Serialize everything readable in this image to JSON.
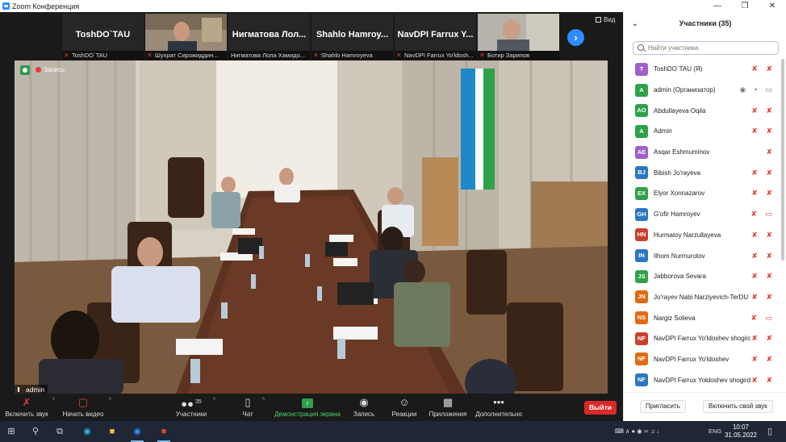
{
  "window": {
    "title": "Zoom Конференция",
    "buttons": [
      "—",
      "❒",
      "✕"
    ]
  },
  "gallery": {
    "tiles": [
      {
        "big": "ToshDO`TAU",
        "caption": "ToshDO`TAU",
        "muted": true,
        "photo": false
      },
      {
        "big": "",
        "caption": "Шухрат Сирожиддин...",
        "muted": true,
        "photo": true
      },
      {
        "big": "Нигматова Лол...",
        "caption": "Нигматова Лола Хамидо...",
        "muted": false,
        "photo": false
      },
      {
        "big": "Shahlo Hamroy...",
        "caption": "Shahlo Hamroyeva",
        "muted": true,
        "photo": false
      },
      {
        "big": "NavDPI Farrux Y...",
        "caption": "NavDPI Farrux Yo'ldosh...",
        "muted": true,
        "photo": false
      },
      {
        "big": "",
        "caption": "Ботир Зарипов",
        "muted": true,
        "photo": true
      }
    ],
    "view_label": "Вид"
  },
  "main_video": {
    "recording_label": "Запись",
    "speaker_name": "admin"
  },
  "toolbar": {
    "unmute": "Включить звук",
    "start_video": "Начать видео",
    "participants": "Участники",
    "participants_count": "35",
    "chat": "Чат",
    "share_screen": "Демонстрация экрана",
    "record": "Запись",
    "reactions": "Реакции",
    "apps": "Приложения",
    "more": "Дополнительно",
    "leave": "Выйти"
  },
  "panel": {
    "title": "Участники (35)",
    "search_placeholder": "Найти участника",
    "participants": [
      {
        "initials": "T",
        "name": "ToshDO`TAU (Я)",
        "color": "#a05fc9",
        "icons": "mic-off video-off"
      },
      {
        "initials": "A",
        "name": "admin (Организатор)",
        "color": "#2ea14a",
        "icons": "active"
      },
      {
        "initials": "AO",
        "name": "Abdullayeva Oqila",
        "color": "#2ea14a",
        "icons": "mic-off video-off"
      },
      {
        "initials": "A",
        "name": "Admin",
        "color": "#2ea14a",
        "icons": "mic-off video-off"
      },
      {
        "initials": "AE",
        "name": "Asqar Eshmuminov",
        "color": "#a05fc9",
        "icons": "mic-off"
      },
      {
        "initials": "BJ",
        "name": "Bibish Jo'rayeva",
        "color": "#2d76c2",
        "icons": "mic-off video-off"
      },
      {
        "initials": "EX",
        "name": "Elyor Xonnazarov",
        "color": "#2ea14a",
        "icons": "mic-off video-off"
      },
      {
        "initials": "GH",
        "name": "G'ofir Hamroyev",
        "color": "#2d76c2",
        "icons": "mic-off video-on"
      },
      {
        "initials": "HN",
        "name": "Hurmatoy Narzullayeva",
        "color": "#c94030",
        "icons": "mic-off video-off"
      },
      {
        "initials": "IN",
        "name": "Ilhom Nurmurotov",
        "color": "#2d76c2",
        "icons": "mic-off video-off"
      },
      {
        "initials": "JS",
        "name": "Jabborova Sevara",
        "color": "#2ea14a",
        "icons": "mic-off video-off"
      },
      {
        "initials": "JN",
        "name": "Jo'rayev Nabi Narziyevich-TerDU",
        "color": "#e06a10",
        "icons": "mic-off video-off"
      },
      {
        "initials": "NS",
        "name": "Nargiz Solieva",
        "color": "#e06a10",
        "icons": "mic-off video-on"
      },
      {
        "initials": "NF",
        "name": "NavDPI Farrux Yo'ldoshev shogird...",
        "color": "#c94030",
        "icons": "mic-off video-off"
      },
      {
        "initials": "NF",
        "name": "NavDPI Farrux Yo'ldoshev",
        "color": "#e06a10",
        "icons": "mic-off video-off"
      },
      {
        "initials": "NF",
        "name": "NavDPI Farrux Yoldoshev shogird...",
        "color": "#2d76c2",
        "icons": "mic-off video-off"
      }
    ],
    "invite": "Пригласить",
    "unmute_me": "Включить свой звук"
  },
  "taskbar": {
    "lang": "ENG",
    "time": "10:07",
    "date": "31.05.2022"
  }
}
